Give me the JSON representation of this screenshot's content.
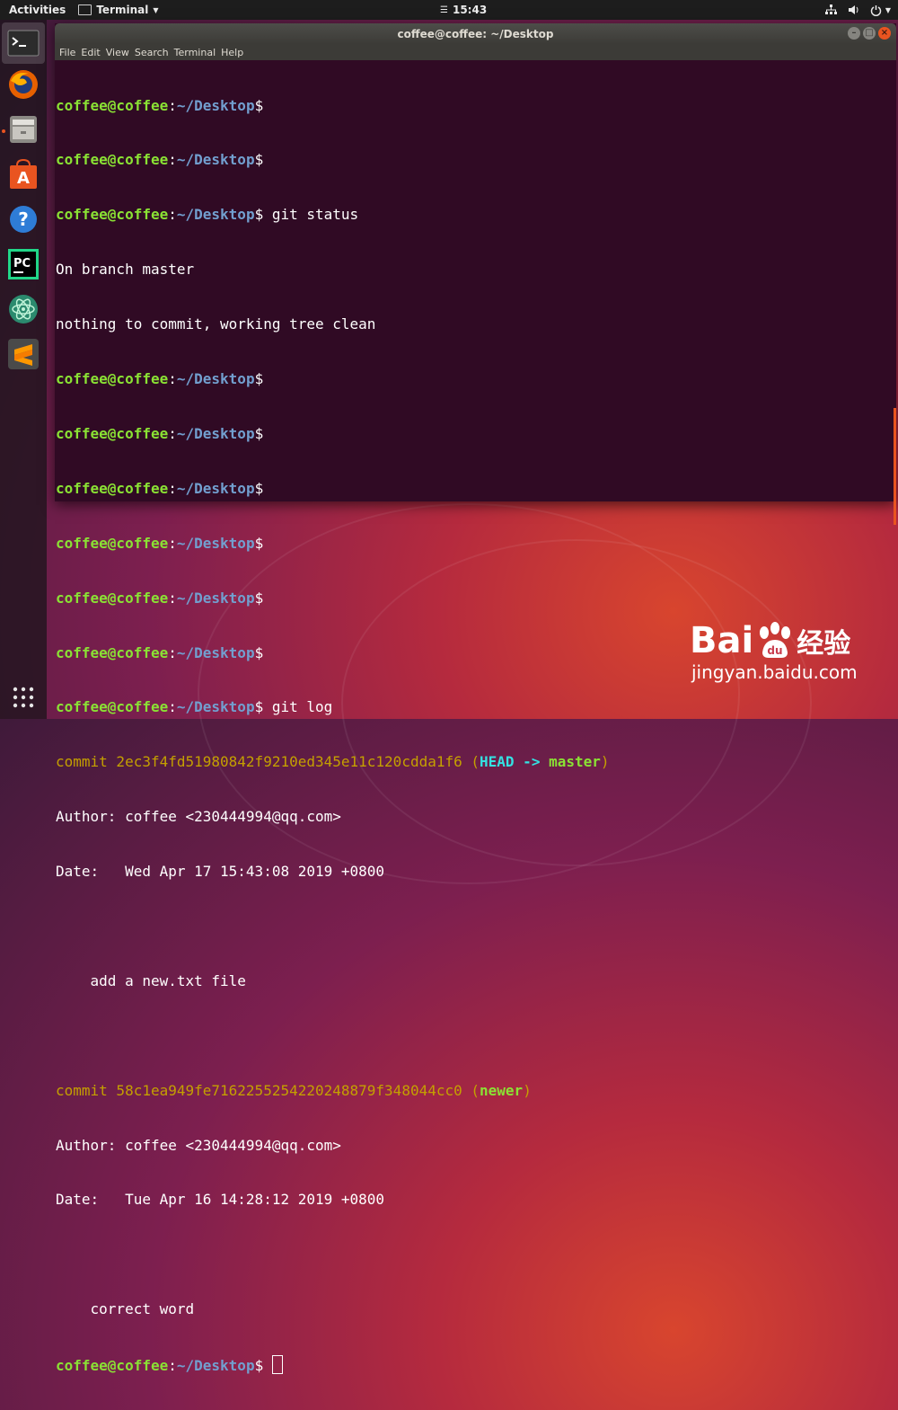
{
  "topbar": {
    "activities": "Activities",
    "app_menu": "Terminal",
    "clock": "15:43"
  },
  "dock": {
    "items": [
      "terminal-icon",
      "firefox-icon",
      "files-icon",
      "software-center-icon",
      "help-icon",
      "pycharm-icon",
      "atom-icon",
      "sublime-text-icon"
    ],
    "pycharm_label": "PC",
    "apps_grid": "show-applications-icon"
  },
  "window": {
    "title": "coffee@coffee: ~/Desktop",
    "menu": [
      "File",
      "Edit",
      "View",
      "Search",
      "Terminal",
      "Help"
    ]
  },
  "terminal": {
    "user": "coffee@coffee",
    "path": "~/Desktop",
    "cmd_status": "git status",
    "status_line1": "On branch master",
    "status_line2": "nothing to commit, working tree clean",
    "cmd_log": "git log",
    "commit1_prefix": "commit 2ec3f4fd51980842f9210ed345e11c120cdda1f6",
    "commit1_head": "HEAD -> ",
    "commit1_branch": "master",
    "commit1_author": "Author: coffee <230444994@qq.com>",
    "commit1_date": "Date:   Wed Apr 17 15:43:08 2019 +0800",
    "commit1_msg": "    add a new.txt file",
    "commit2_prefix": "commit 58c1ea949fe716225525422024887 9f348044cc0",
    "commit2_hash_full": "commit 58c1ea949fe716225525422024887 9f348044cc0",
    "commit2_branch": "newer",
    "commit2_author": "Author: coffee <230444994@qq.com>",
    "commit2_date": "Date:   Tue Apr 16 14:28:12 2019 +0800",
    "commit2_msg": "    correct word"
  },
  "watermark": {
    "logo_text": "Bai",
    "logo_text2": "du",
    "logo_cn": "经验",
    "site": "jingyan.baidu.com"
  },
  "colors": {
    "terminal_bg": "#300a24",
    "prompt_user": "#8ae234",
    "prompt_path": "#729fcf",
    "commit_hash": "#c4a000",
    "head": "#34e2e2",
    "accent": "#e95420"
  }
}
